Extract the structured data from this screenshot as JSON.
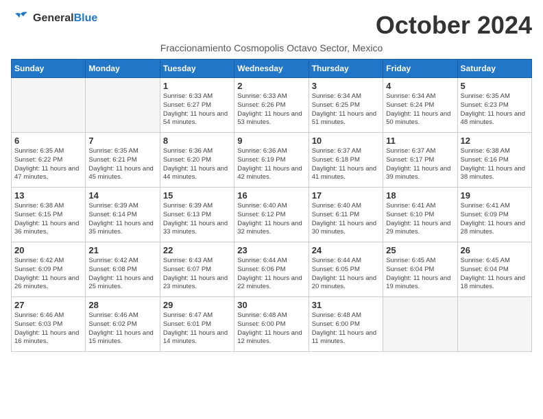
{
  "header": {
    "logo_general": "General",
    "logo_blue": "Blue",
    "month_title": "October 2024",
    "subtitle": "Fraccionamiento Cosmopolis Octavo Sector, Mexico"
  },
  "weekdays": [
    "Sunday",
    "Monday",
    "Tuesday",
    "Wednesday",
    "Thursday",
    "Friday",
    "Saturday"
  ],
  "weeks": [
    [
      {
        "day": "",
        "empty": true
      },
      {
        "day": "",
        "empty": true
      },
      {
        "day": "1",
        "sunrise": "6:33 AM",
        "sunset": "6:27 PM",
        "daylight": "11 hours and 54 minutes."
      },
      {
        "day": "2",
        "sunrise": "6:33 AM",
        "sunset": "6:26 PM",
        "daylight": "11 hours and 53 minutes."
      },
      {
        "day": "3",
        "sunrise": "6:34 AM",
        "sunset": "6:25 PM",
        "daylight": "11 hours and 51 minutes."
      },
      {
        "day": "4",
        "sunrise": "6:34 AM",
        "sunset": "6:24 PM",
        "daylight": "11 hours and 50 minutes."
      },
      {
        "day": "5",
        "sunrise": "6:35 AM",
        "sunset": "6:23 PM",
        "daylight": "11 hours and 48 minutes."
      }
    ],
    [
      {
        "day": "6",
        "sunrise": "6:35 AM",
        "sunset": "6:22 PM",
        "daylight": "11 hours and 47 minutes."
      },
      {
        "day": "7",
        "sunrise": "6:35 AM",
        "sunset": "6:21 PM",
        "daylight": "11 hours and 45 minutes."
      },
      {
        "day": "8",
        "sunrise": "6:36 AM",
        "sunset": "6:20 PM",
        "daylight": "11 hours and 44 minutes."
      },
      {
        "day": "9",
        "sunrise": "6:36 AM",
        "sunset": "6:19 PM",
        "daylight": "11 hours and 42 minutes."
      },
      {
        "day": "10",
        "sunrise": "6:37 AM",
        "sunset": "6:18 PM",
        "daylight": "11 hours and 41 minutes."
      },
      {
        "day": "11",
        "sunrise": "6:37 AM",
        "sunset": "6:17 PM",
        "daylight": "11 hours and 39 minutes."
      },
      {
        "day": "12",
        "sunrise": "6:38 AM",
        "sunset": "6:16 PM",
        "daylight": "11 hours and 38 minutes."
      }
    ],
    [
      {
        "day": "13",
        "sunrise": "6:38 AM",
        "sunset": "6:15 PM",
        "daylight": "11 hours and 36 minutes."
      },
      {
        "day": "14",
        "sunrise": "6:39 AM",
        "sunset": "6:14 PM",
        "daylight": "11 hours and 35 minutes."
      },
      {
        "day": "15",
        "sunrise": "6:39 AM",
        "sunset": "6:13 PM",
        "daylight": "11 hours and 33 minutes."
      },
      {
        "day": "16",
        "sunrise": "6:40 AM",
        "sunset": "6:12 PM",
        "daylight": "11 hours and 32 minutes."
      },
      {
        "day": "17",
        "sunrise": "6:40 AM",
        "sunset": "6:11 PM",
        "daylight": "11 hours and 30 minutes."
      },
      {
        "day": "18",
        "sunrise": "6:41 AM",
        "sunset": "6:10 PM",
        "daylight": "11 hours and 29 minutes."
      },
      {
        "day": "19",
        "sunrise": "6:41 AM",
        "sunset": "6:09 PM",
        "daylight": "11 hours and 28 minutes."
      }
    ],
    [
      {
        "day": "20",
        "sunrise": "6:42 AM",
        "sunset": "6:09 PM",
        "daylight": "11 hours and 26 minutes."
      },
      {
        "day": "21",
        "sunrise": "6:42 AM",
        "sunset": "6:08 PM",
        "daylight": "11 hours and 25 minutes."
      },
      {
        "day": "22",
        "sunrise": "6:43 AM",
        "sunset": "6:07 PM",
        "daylight": "11 hours and 23 minutes."
      },
      {
        "day": "23",
        "sunrise": "6:44 AM",
        "sunset": "6:06 PM",
        "daylight": "11 hours and 22 minutes."
      },
      {
        "day": "24",
        "sunrise": "6:44 AM",
        "sunset": "6:05 PM",
        "daylight": "11 hours and 20 minutes."
      },
      {
        "day": "25",
        "sunrise": "6:45 AM",
        "sunset": "6:04 PM",
        "daylight": "11 hours and 19 minutes."
      },
      {
        "day": "26",
        "sunrise": "6:45 AM",
        "sunset": "6:04 PM",
        "daylight": "11 hours and 18 minutes."
      }
    ],
    [
      {
        "day": "27",
        "sunrise": "6:46 AM",
        "sunset": "6:03 PM",
        "daylight": "11 hours and 16 minutes."
      },
      {
        "day": "28",
        "sunrise": "6:46 AM",
        "sunset": "6:02 PM",
        "daylight": "11 hours and 15 minutes."
      },
      {
        "day": "29",
        "sunrise": "6:47 AM",
        "sunset": "6:01 PM",
        "daylight": "11 hours and 14 minutes."
      },
      {
        "day": "30",
        "sunrise": "6:48 AM",
        "sunset": "6:00 PM",
        "daylight": "11 hours and 12 minutes."
      },
      {
        "day": "31",
        "sunrise": "6:48 AM",
        "sunset": "6:00 PM",
        "daylight": "11 hours and 11 minutes."
      },
      {
        "day": "",
        "empty": true
      },
      {
        "day": "",
        "empty": true
      }
    ]
  ]
}
